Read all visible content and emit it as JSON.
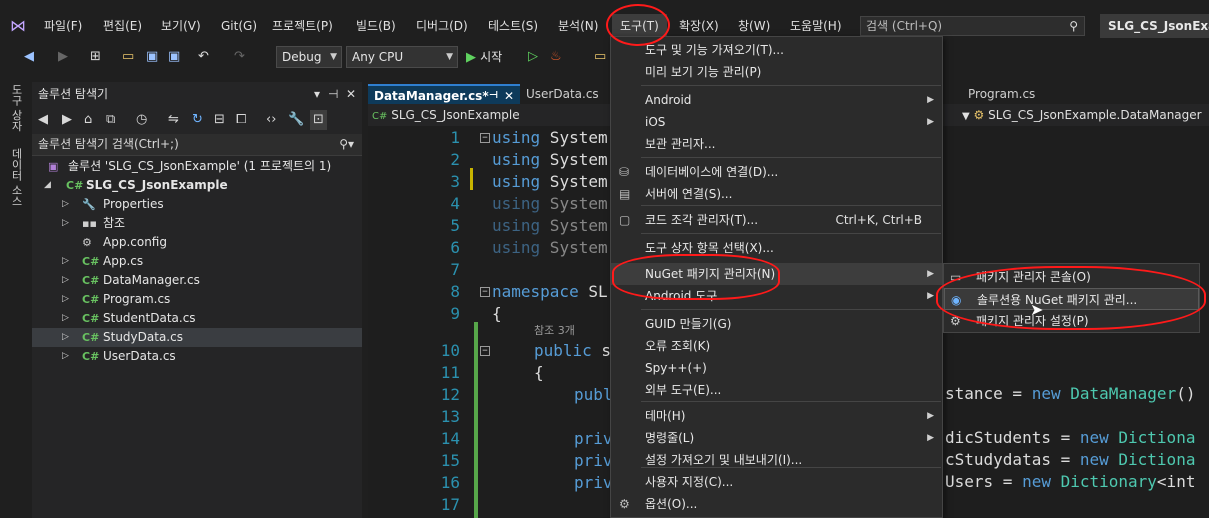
{
  "colors": {
    "accent": "#c3a6ff",
    "annotation": "#ff1a1a",
    "kw": "#569cd6",
    "type": "#4ec9b0",
    "lineno": "#2b91af"
  },
  "menubar": {
    "items": [
      "파일(F)",
      "편집(E)",
      "보기(V)",
      "Git(G)",
      "프로젝트(P)",
      "빌드(B)",
      "디버그(D)",
      "테스트(S)",
      "분석(N)",
      "도구(T)",
      "확장(X)",
      "창(W)",
      "도움말(H)"
    ],
    "search_placeholder": "검색 (Ctrl+Q)",
    "solution_name": "SLG_CS_JsonExample"
  },
  "toolbar": {
    "config": "Debug",
    "platform": "Any CPU",
    "start_label": "시작"
  },
  "side_tabs": [
    "도구 상자",
    "데이터 소스"
  ],
  "solution_explorer": {
    "title": "솔루션 탐색기",
    "search_placeholder": "솔루션 탐색기 검색(Ctrl+;)",
    "solution_line": "솔루션 'SLG_CS_JsonExample' (1 프로젝트의 1)",
    "project": "SLG_CS_JsonExample",
    "items": [
      {
        "label": "Properties",
        "icon": "wrench-icon",
        "glyph": "🔧",
        "color": "#cfcfcf"
      },
      {
        "label": "참조",
        "icon": "references-icon",
        "glyph": "▪▪",
        "color": "#cfcfcf"
      },
      {
        "label": "App.config",
        "icon": "config-file-icon",
        "glyph": "⚙",
        "color": "#cfcfcf"
      },
      {
        "label": "App.cs",
        "icon": "csharp-file-icon",
        "glyph": "C#",
        "color": "#68c160"
      },
      {
        "label": "DataManager.cs",
        "icon": "csharp-file-icon",
        "glyph": "C#",
        "color": "#68c160"
      },
      {
        "label": "Program.cs",
        "icon": "csharp-file-icon",
        "glyph": "C#",
        "color": "#68c160"
      },
      {
        "label": "StudentData.cs",
        "icon": "csharp-file-icon",
        "glyph": "C#",
        "color": "#68c160"
      },
      {
        "label": "StudyData.cs",
        "icon": "csharp-file-icon",
        "glyph": "C#",
        "color": "#68c160"
      },
      {
        "label": "UserData.cs",
        "icon": "csharp-file-icon",
        "glyph": "C#",
        "color": "#68c160"
      }
    ]
  },
  "editor": {
    "tabs": [
      "DataManager.cs*",
      "UserData.cs",
      "Program.cs"
    ],
    "nav_left": "SLG_CS_JsonExample",
    "nav_right": "SLG_CS_JsonExample.DataManager",
    "ref_hint": "참조 3개",
    "lines": [
      {
        "n": "1",
        "text": "using System"
      },
      {
        "n": "2",
        "text": "using System"
      },
      {
        "n": "3",
        "text": "using System"
      },
      {
        "n": "4",
        "text": "using System"
      },
      {
        "n": "5",
        "text": "using System"
      },
      {
        "n": "6",
        "text": "using System"
      },
      {
        "n": "7",
        "text": ""
      },
      {
        "n": "8",
        "text": "namespace SL"
      },
      {
        "n": "9",
        "text": "{"
      },
      {
        "n": "10",
        "text": "public s"
      },
      {
        "n": "11",
        "text": "{"
      },
      {
        "n": "12",
        "text": "publ"
      },
      {
        "n": "13",
        "text": ""
      },
      {
        "n": "14",
        "text": "priv"
      },
      {
        "n": "15",
        "text": "priv"
      },
      {
        "n": "16",
        "text": "priv"
      },
      {
        "n": "17",
        "text": ""
      }
    ],
    "right_fragments": {
      "l12a": "stance = ",
      "l12b": "new ",
      "l12c": "DataManager",
      "l12d": "()",
      "l14a": "dicStudents = ",
      "l14b": "new ",
      "l14c": "Dictiona",
      "l15a": "cStudydatas = ",
      "l15b": "new ",
      "l15c": "Dictiona",
      "l16a": "Users = ",
      "l16b": "new ",
      "l16c": "Dictionary",
      "l16d": "<int"
    }
  },
  "tools_menu": {
    "items": [
      {
        "label": "도구 및 기능 가져오기(T)...",
        "icon": "",
        "sub": false,
        "shortcut": ""
      },
      {
        "label": "미리 보기 기능 관리(P)",
        "icon": "",
        "sub": false,
        "shortcut": ""
      },
      {
        "label": "Android",
        "icon": "",
        "sub": true,
        "shortcut": ""
      },
      {
        "label": "iOS",
        "icon": "",
        "sub": true,
        "shortcut": ""
      },
      {
        "label": "보관 관리자...",
        "icon": "",
        "sub": false,
        "shortcut": ""
      },
      {
        "label": "데이터베이스에 연결(D)...",
        "icon": "db-connect-icon",
        "sub": false,
        "shortcut": ""
      },
      {
        "label": "서버에 연결(S)...",
        "icon": "server-connect-icon",
        "sub": false,
        "shortcut": ""
      },
      {
        "label": "코드 조각 관리자(T)...",
        "icon": "snippet-icon",
        "sub": false,
        "shortcut": "Ctrl+K, Ctrl+B"
      },
      {
        "label": "도구 상자 항목 선택(X)...",
        "icon": "",
        "sub": false,
        "shortcut": ""
      },
      {
        "label": "NuGet 패키지 관리자(N)",
        "icon": "",
        "sub": true,
        "shortcut": ""
      },
      {
        "label": "Android 도구",
        "icon": "",
        "sub": true,
        "shortcut": ""
      },
      {
        "label": "GUID 만들기(G)",
        "icon": "",
        "sub": false,
        "shortcut": ""
      },
      {
        "label": "오류 조회(K)",
        "icon": "",
        "sub": false,
        "shortcut": ""
      },
      {
        "label": "Spy++(+)",
        "icon": "",
        "sub": false,
        "shortcut": ""
      },
      {
        "label": "외부 도구(E)...",
        "icon": "",
        "sub": false,
        "shortcut": ""
      },
      {
        "label": "테마(H)",
        "icon": "",
        "sub": true,
        "shortcut": ""
      },
      {
        "label": "명령줄(L)",
        "icon": "",
        "sub": true,
        "shortcut": ""
      },
      {
        "label": "설정 가져오기 및 내보내기(I)...",
        "icon": "",
        "sub": false,
        "shortcut": ""
      },
      {
        "label": "사용자 지정(C)...",
        "icon": "",
        "sub": false,
        "shortcut": ""
      },
      {
        "label": "옵션(O)...",
        "icon": "gear-icon",
        "sub": false,
        "shortcut": ""
      }
    ]
  },
  "nuget_submenu": {
    "items": [
      {
        "label": "패키지 관리자 콘솔(O)",
        "icon": "console-icon"
      },
      {
        "label": "솔루션용 NuGet 패키지 관리...",
        "icon": "nuget-icon"
      },
      {
        "label": "패키지 관리자 설정(P)",
        "icon": "gear-icon"
      }
    ]
  }
}
